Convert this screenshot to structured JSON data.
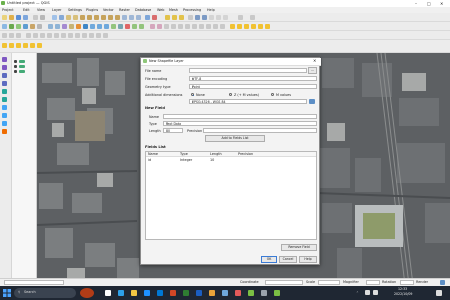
{
  "window": {
    "title": "Untitled project — QGIS"
  },
  "menubar": {
    "items": [
      "Project",
      "Edit",
      "View",
      "Layer",
      "Settings",
      "Plugins",
      "Vector",
      "Raster",
      "Database",
      "Web",
      "Mesh",
      "Processing",
      "Help"
    ]
  },
  "dialog": {
    "title": "New Shapefile Layer",
    "file_name_label": "File name",
    "file_encoding_label": "File encoding",
    "file_encoding_value": "UTF-8",
    "geometry_type_label": "Geometry type",
    "geometry_type_value": "Point",
    "additional_dims_label": "Additional dimensions",
    "dim_none": "None",
    "dim_z": "Z (+ M values)",
    "dim_m": "M values",
    "crs_value": "EPSG:4326 - WGS 84",
    "new_field_section": "New Field",
    "name_label": "Name",
    "name_value": "",
    "type_label": "Type",
    "type_value": "Text Data",
    "length_label": "Length",
    "length_value": "80",
    "precision_label": "Precision",
    "add_to_fields_button": "Add to Fields List",
    "fields_list_section": "Fields List",
    "col_name": "Name",
    "col_type": "Type",
    "col_length": "Length",
    "col_precision": "Precision",
    "rows": [
      {
        "name": "id",
        "type": "Integer",
        "length": "10",
        "precision": ""
      }
    ],
    "remove_field_button": "Remove Field",
    "ok_button": "OK",
    "cancel_button": "Cancel",
    "help_button": "Help"
  },
  "taskbar": {
    "search_placeholder": "Search",
    "time": "12:33",
    "date": "2022/10/09"
  },
  "statusbar": {
    "coordinate_label": "Coordinate",
    "scale_label": "Scale",
    "magnifier_label": "Magnifier",
    "rotation_label": "Rotation",
    "render_label": "Render"
  }
}
